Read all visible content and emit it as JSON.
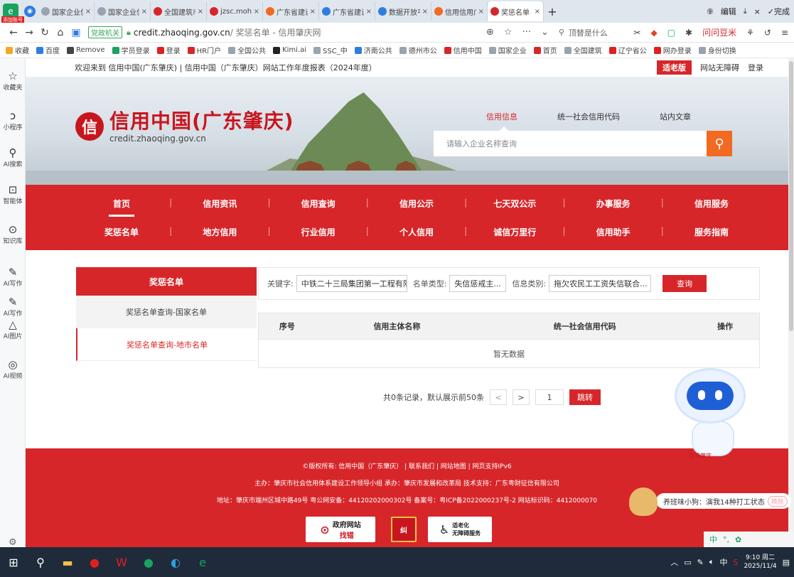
{
  "browser": {
    "app_badge": "添加账号",
    "tabs": [
      {
        "label": "国家企业信",
        "color": "#9aa4b0"
      },
      {
        "label": "国家企业信",
        "color": "#9aa4b0"
      },
      {
        "label": "全国建筑市",
        "color": "#d7262a"
      },
      {
        "label": "jzsc.mohu",
        "color": "#d7262a"
      },
      {
        "label": "广东省建设",
        "color": "#f26a21"
      },
      {
        "label": "广东省建设",
        "color": "#2f7de1"
      },
      {
        "label": "数据开放平",
        "color": "#2f7de1"
      },
      {
        "label": "信用信用广",
        "color": "#f26a21"
      },
      {
        "label": "奖惩名单",
        "color": "#d7262a",
        "active": true
      }
    ],
    "new_tab": "+",
    "window_controls": {
      "edit": "编辑",
      "download": "⤓",
      "close": "×",
      "done": "✓完成"
    },
    "address": {
      "gov_badge": "党政机关",
      "host": "credit.zhaoqing.gov.cn",
      "path": " / 奖惩名单 - 信用肇庆网"
    },
    "search_placeholder": "顶替是什么",
    "bookmarks": [
      "收藏",
      "百度",
      "Remove",
      "学员登录",
      "登录",
      "HR门户",
      "全国公共",
      "Kimi.ai",
      "SSC_中",
      "济南公共",
      "德州市公",
      "信用中国",
      "国家企业",
      "首页",
      "全国建筑",
      "辽宁省公",
      "网办登录",
      "身份切换"
    ],
    "ask_label": "问问豆米"
  },
  "sidebar": [
    {
      "icon": "☆",
      "label": "收藏夹"
    },
    {
      "icon": "ↄ",
      "label": "小程序"
    },
    {
      "icon": "⚲",
      "label": "AI搜索"
    },
    {
      "icon": "⊡",
      "label": "智能体"
    },
    {
      "icon": "⊙",
      "label": "知识库"
    },
    {
      "icon": "✎",
      "label": "AI写作"
    },
    {
      "icon": "✎",
      "label": "AI写作"
    },
    {
      "icon": "△",
      "label": "AI图片"
    },
    {
      "icon": "◎",
      "label": "AI视频"
    }
  ],
  "page": {
    "welcome": "欢迎来到 信用中国(广东肇庆)  |  信用中国（广东肇庆）网站工作年度报表（2024年度）",
    "elder_mode": "适老版",
    "accessibility": "网站无障碍",
    "login": "登录",
    "logo_seal": "信",
    "logo_title": "信用中国(广东肇庆)",
    "logo_domain": "credit.zhaoqing.gov.cn",
    "top_nav": [
      "信用信息",
      "统一社会信用代码",
      "站内文章"
    ],
    "search_placeholder": "请输入企业名称查询",
    "nav_row1": [
      "首页",
      "信用资讯",
      "信用查询",
      "信用公示",
      "七天双公示",
      "办事服务",
      "信用服务"
    ],
    "nav_row2": [
      "奖惩名单",
      "地方信用",
      "行业信用",
      "个人信用",
      "诚信万里行",
      "信用助手",
      "服务指南"
    ],
    "left_panel": {
      "title": "奖惩名单",
      "items": [
        "奖惩名单查询-国家名单",
        "奖惩名单查询-地市名单"
      ]
    },
    "filter": {
      "keyword_label": "关键字:",
      "keyword_value": "中铁二十三局集团第一工程有限",
      "type_label": "名单类型:",
      "type_value": "失信惩戒主...",
      "category_label": "信息类别:",
      "category_value": "拖欠农民工工资失信联合...",
      "query_button": "查询"
    },
    "table": {
      "headers": [
        "序号",
        "信用主体名称",
        "统一社会信用代码",
        "操作"
      ],
      "empty": "暂无数据"
    },
    "pager": {
      "summary": "共0条记录，默认展示前50条",
      "prev": "<",
      "next": ">",
      "page": "1",
      "jump": "跳转"
    },
    "footer": {
      "line1": "©版权所有: 信用中国（广东肇庆）  |  联系我们  |  网站地图  |  网页支持IPv6",
      "line2": "主办：肇庆市社会信用体系建设工作领导小组      承办：肇庆市发展和改革局      技术支持：广东粤财征信有限公司",
      "line3": "地址：肇庆市端州区城中路49号      粤公网安备：44120202000302号      备案号：粤ICP备2022000237号-2      网站标识码：4412000070",
      "badge1_title": "政府网站",
      "badge1_sub": "找错",
      "badge2": "纠",
      "badge3_title": "适老化",
      "badge3_sub": "无障碍服务"
    },
    "assistant_label": "信用肇庆"
  },
  "toast": {
    "text": "养班味小狗：演我14种打工状态",
    "action": "换肤"
  },
  "ime": {
    "label": "中"
  },
  "taskbar": {
    "time": "9:10 周二",
    "date": "2025/11/4",
    "ime": "中"
  },
  "colors": {
    "brand_red": "#d7262a",
    "search_orange": "#f26a21"
  }
}
